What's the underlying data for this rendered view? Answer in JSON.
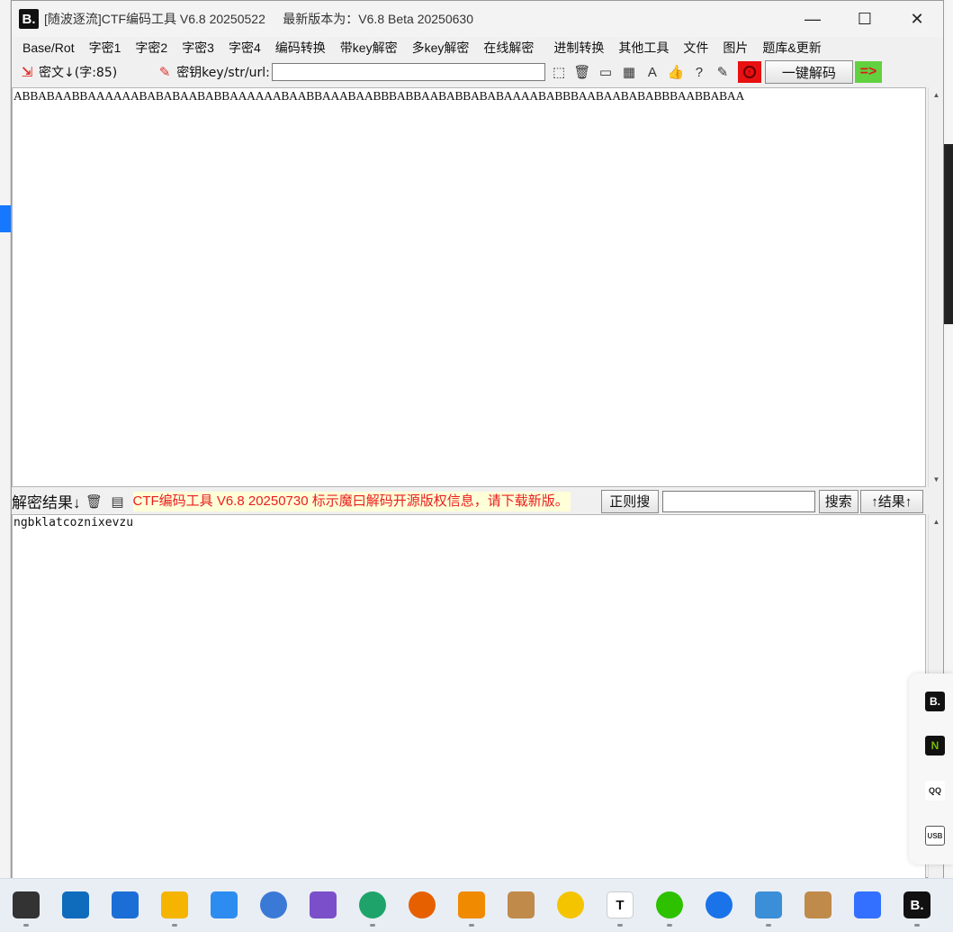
{
  "window": {
    "logo": "B.",
    "title": "[随波逐流]CTF编码工具 V6.8 20250522     最新版本为：V6.8 Beta 20250630",
    "minimize": "—",
    "maximize": "☐",
    "close": "✕"
  },
  "menu": [
    "Base/Rot",
    "字密1",
    "字密2",
    "字密3",
    "字密4",
    "编码转换",
    "带key解密",
    "多key解密",
    "在线解密",
    "进制转换",
    "其他工具",
    "文件",
    "图片",
    "题库&更新"
  ],
  "toolbar": {
    "cipher_label": "密文↓(字:85)",
    "key_label": "密钥key/str/url:",
    "key_value": "",
    "decode_button": "一键解码",
    "next_arrow": "=>"
  },
  "cipher_text": "ABBABAABBAAAAAABABABAABABBAAAAAABAABBAAABAABBBABBAABABBABABAAAABABBBAABAABABABBBAABBABAA",
  "result_bar": {
    "label": "解密结果↓",
    "notice": "CTF编码工具 V6.8 20250730 标示魔曰解码开源版权信息，请下载新版。",
    "regex_button": "正则搜",
    "search_value": "",
    "search_button": "搜索",
    "result_nav_button": "↑结果↑"
  },
  "result_text": "ngbklatcoznixevzu",
  "side_panel": [
    "B.",
    "N",
    "QQ",
    "USB"
  ],
  "taskbar_apps": [
    "terminal",
    "store",
    "mathtype",
    "files",
    "app-a",
    "settings",
    "visual-studio",
    "edge",
    "firefox",
    "vm-app",
    "package",
    "sunlogin",
    "typora",
    "wechat",
    "thunder",
    "notepad",
    "package-2",
    "feishu",
    "ctf-tool"
  ],
  "colors": {
    "notice_text": "#e81e1e",
    "upload_button": "#e81010",
    "arrow_button": "#62d13f"
  }
}
